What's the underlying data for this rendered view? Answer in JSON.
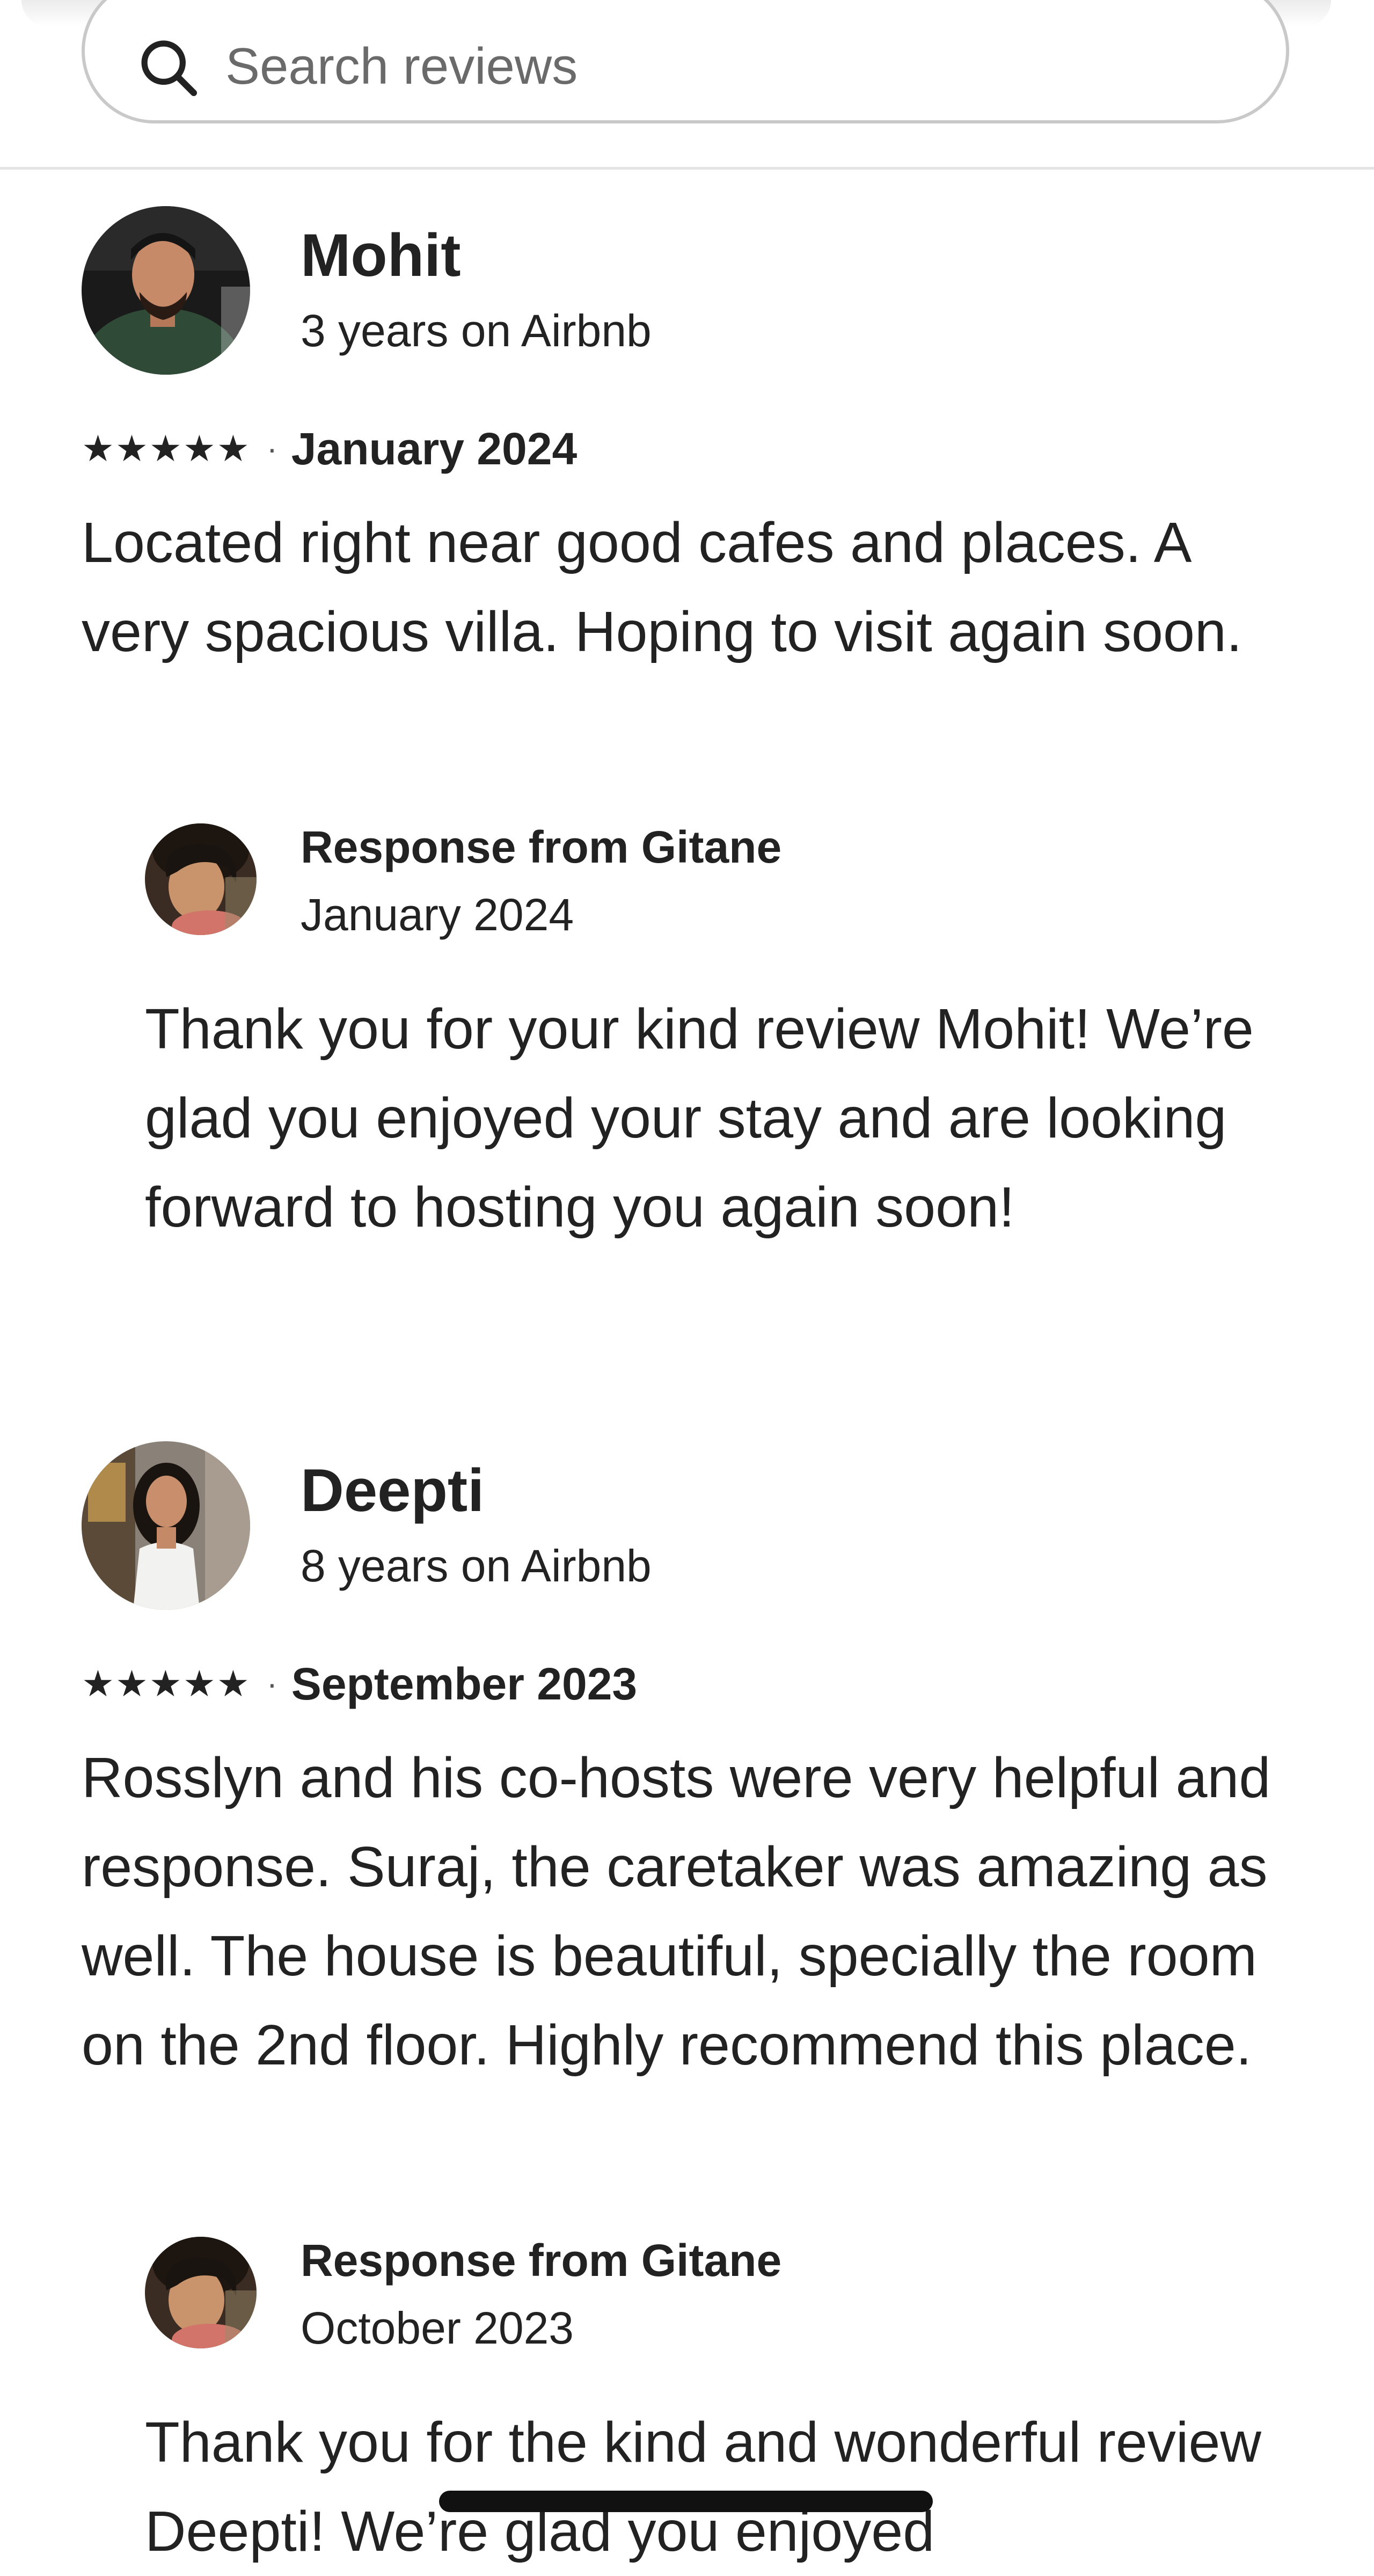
{
  "search": {
    "placeholder": "Search reviews",
    "icon": "search-icon"
  },
  "reviews": [
    {
      "name": "Mohit",
      "tenure": "3 years on Airbnb",
      "rating": 5,
      "stars": "★★★★★",
      "separator": "·",
      "date": "January 2024",
      "text": "Located right near good cafes and places. A very spacious villa. Hoping to visit again soon.",
      "response": {
        "title": "Response from Gitane",
        "date": "January 2024",
        "text": "Thank you for your kind review Mohit! We’re glad you enjoyed your stay and are looking forward to hosting you again soon!"
      }
    },
    {
      "name": "Deepti",
      "tenure": "8 years on Airbnb",
      "rating": 5,
      "stars": "★★★★★",
      "separator": "·",
      "date": "September 2023",
      "text": "Rosslyn and his co-hosts were very helpful and response. Suraj, the caretaker was amazing as well. The house is beautiful, specially the room on the 2nd floor. Highly recommend this place.",
      "response": {
        "title": "Response from Gitane",
        "date": "October 2023",
        "text": "Thank you for the kind and wonderful review Deepti! We’re glad you enjoyed"
      }
    }
  ],
  "colors": {
    "text": "#222222",
    "muted": "#6a6a6a",
    "border": "#c9c9c9",
    "divider": "#e3e3e3"
  }
}
